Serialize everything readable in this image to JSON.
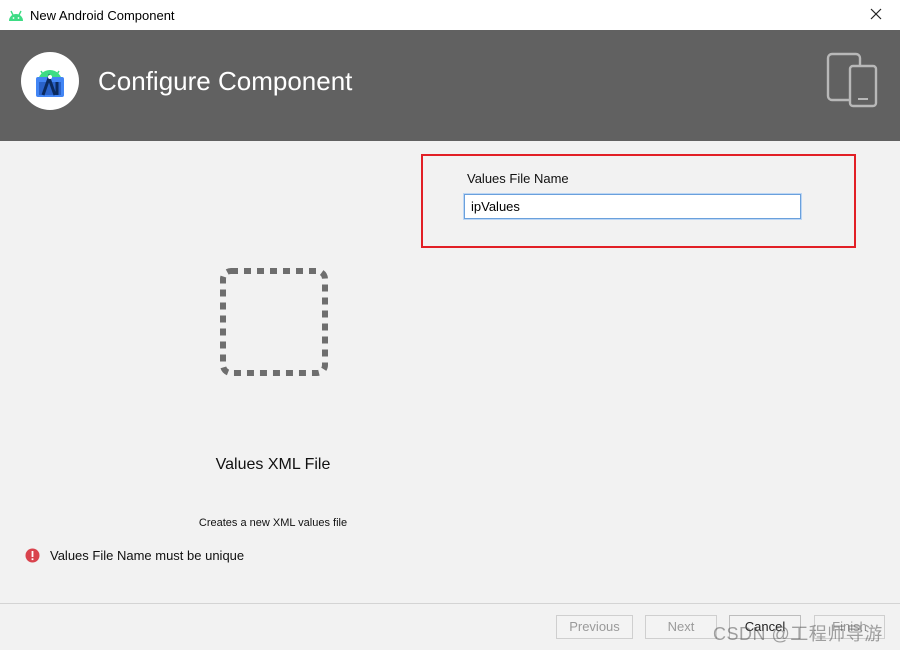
{
  "window": {
    "title": "New Android Component",
    "close_icon": "close-icon"
  },
  "banner": {
    "heading": "Configure Component",
    "logo_icon": "android-studio-logo",
    "devices_icon": "devices-icon"
  },
  "form": {
    "field_label": "Values File Name",
    "field_value": "ipValues"
  },
  "template": {
    "icon": "dashed-square-icon",
    "title": "Values XML File",
    "description": "Creates a new XML values file"
  },
  "validation": {
    "icon": "error-icon",
    "message": "Values File Name must be unique",
    "color": "#d9434d"
  },
  "buttons": {
    "previous": "Previous",
    "next": "Next",
    "cancel": "Cancel",
    "finish": "Finish"
  },
  "watermark": "CSDN @工程师导游",
  "colors": {
    "banner": "#616161",
    "highlight_border": "#e21f26",
    "android_green": "#3ddc84"
  }
}
